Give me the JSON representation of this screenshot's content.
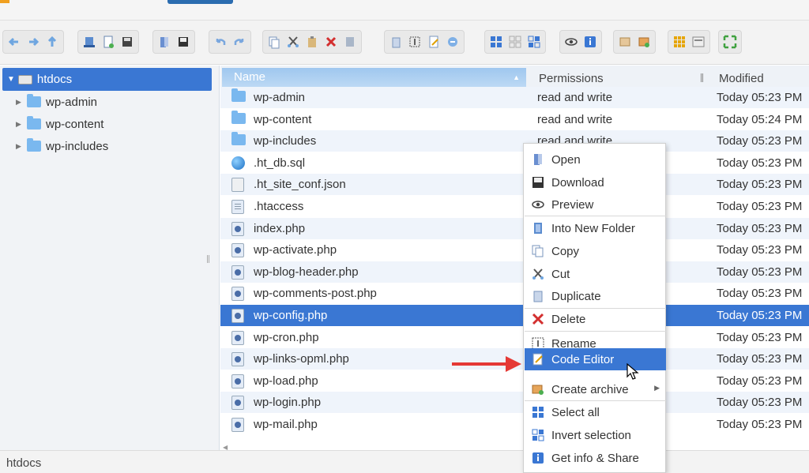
{
  "toolbar": {
    "groups": [
      [
        "back-icon",
        "forward-icon",
        "up-icon"
      ],
      [
        "reload-icon",
        "new-file-icon",
        "save-icon"
      ],
      [
        "open-icon",
        "download-icon"
      ],
      [
        "undo-icon",
        "redo-icon"
      ],
      [
        "copy-icon",
        "cut-icon",
        "paste-icon",
        "delete-icon",
        "empty-icon"
      ],
      [
        "duplicate-icon",
        "rename-icon",
        "edit-icon",
        "resize-icon"
      ],
      [
        "select-all-icon",
        "select-none-icon",
        "invert-selection-icon"
      ],
      [
        "preview-icon",
        "info-icon"
      ],
      [
        "extract-icon",
        "archive-icon"
      ],
      [
        "view-icons-icon",
        "view-list-icon"
      ],
      [
        "fullscreen-icon"
      ]
    ]
  },
  "sidebar": {
    "root": {
      "label": "htdocs",
      "expanded": true
    },
    "items": [
      {
        "label": "wp-admin"
      },
      {
        "label": "wp-content"
      },
      {
        "label": "wp-includes"
      }
    ]
  },
  "columns": {
    "name": "Name",
    "permissions": "Permissions",
    "modified": "Modified"
  },
  "files": [
    {
      "name": "wp-admin",
      "type": "folder",
      "permissions": "read and write",
      "modified": "Today 05:23 PM"
    },
    {
      "name": "wp-content",
      "type": "folder",
      "permissions": "read and write",
      "modified": "Today 05:24 PM"
    },
    {
      "name": "wp-includes",
      "type": "folder",
      "permissions": "read and write",
      "modified": "Today 05:23 PM"
    },
    {
      "name": ".ht_db.sql",
      "type": "sql",
      "permissions": "",
      "modified": "Today 05:23 PM"
    },
    {
      "name": ".ht_site_conf.json",
      "type": "json",
      "permissions": "",
      "modified": "Today 05:23 PM"
    },
    {
      "name": ".htaccess",
      "type": "txt",
      "permissions": "",
      "modified": "Today 05:23 PM"
    },
    {
      "name": "index.php",
      "type": "php",
      "permissions": "",
      "modified": "Today 05:23 PM"
    },
    {
      "name": "wp-activate.php",
      "type": "php",
      "permissions": "",
      "modified": "Today 05:23 PM"
    },
    {
      "name": "wp-blog-header.php",
      "type": "php",
      "permissions": "",
      "modified": "Today 05:23 PM"
    },
    {
      "name": "wp-comments-post.php",
      "type": "php",
      "permissions": "",
      "modified": "Today 05:23 PM"
    },
    {
      "name": "wp-config.php",
      "type": "php",
      "permissions": "",
      "modified": "Today 05:23 PM",
      "selected": true
    },
    {
      "name": "wp-cron.php",
      "type": "php",
      "permissions": "",
      "modified": "Today 05:23 PM"
    },
    {
      "name": "wp-links-opml.php",
      "type": "php",
      "permissions": "",
      "modified": "Today 05:23 PM"
    },
    {
      "name": "wp-load.php",
      "type": "php",
      "permissions": "",
      "modified": "Today 05:23 PM"
    },
    {
      "name": "wp-login.php",
      "type": "php",
      "permissions": "",
      "modified": "Today 05:23 PM"
    },
    {
      "name": "wp-mail.php",
      "type": "php",
      "permissions": "",
      "modified": "Today 05:23 PM"
    }
  ],
  "context_menu": {
    "items": [
      {
        "label": "Open",
        "icon": "open-icon"
      },
      {
        "label": "Download",
        "icon": "download-icon"
      },
      {
        "label": "Preview",
        "icon": "preview-icon"
      },
      {
        "label": "Into New Folder",
        "icon": "into-new-folder-icon"
      },
      {
        "label": "Copy",
        "icon": "copy-icon"
      },
      {
        "label": "Cut",
        "icon": "cut-icon"
      },
      {
        "label": "Duplicate",
        "icon": "duplicate-icon"
      },
      {
        "label": "Delete",
        "icon": "delete-icon"
      },
      {
        "label": "Rename",
        "icon": "rename-icon"
      },
      {
        "label": "Code Editor",
        "icon": "code-editor-icon",
        "highlighted": true
      },
      {
        "label": "Create archive",
        "icon": "archive-icon",
        "submenu": true
      },
      {
        "label": "Select all",
        "icon": "select-all-icon"
      },
      {
        "label": "Invert selection",
        "icon": "invert-selection-icon"
      },
      {
        "label": "Get info & Share",
        "icon": "info-icon"
      }
    ]
  },
  "status": {
    "path": "htdocs"
  },
  "colors": {
    "accent": "#3a77d3",
    "folder": "#7ab8ef",
    "pointer_arrow": "#e53935"
  }
}
